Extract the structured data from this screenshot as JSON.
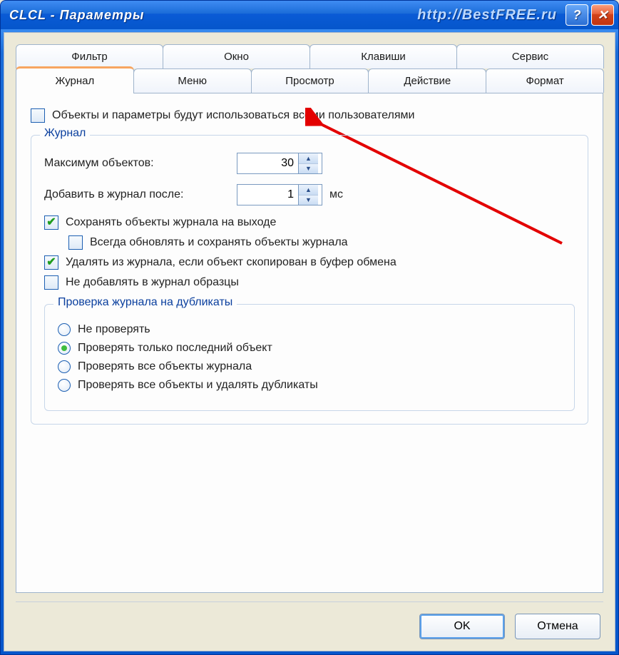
{
  "window": {
    "title": "CLCL - Параметры",
    "watermark": "http://BestFREE.ru"
  },
  "tabs": {
    "row1": [
      "Фильтр",
      "Окно",
      "Клавиши",
      "Сервис"
    ],
    "row2": [
      "Журнал",
      "Меню",
      "Просмотр",
      "Действие",
      "Формат"
    ],
    "active": "Журнал"
  },
  "shared_checkbox": {
    "label": "Объекты и параметры будут использоваться всеми пользователями",
    "checked": false
  },
  "journal_group": {
    "legend": "Журнал",
    "max_objects": {
      "label": "Максимум объектов:",
      "value": "30"
    },
    "add_after": {
      "label": "Добавить в журнал после:",
      "value": "1",
      "unit": "мс"
    },
    "save_on_exit": {
      "label": "Сохранять объекты журнала на выходе",
      "checked": true
    },
    "always_update": {
      "label": "Всегда обновлять и сохранять объекты журнала",
      "checked": false
    },
    "delete_if_copied": {
      "label": "Удалять из журнала, если объект скопирован в буфер обмена",
      "checked": true
    },
    "no_samples": {
      "label": "Не добавлять в журнал образцы",
      "checked": false
    }
  },
  "dup_group": {
    "legend": "Проверка журнала на дубликаты",
    "options": [
      "Не проверять",
      "Проверять только последний объект",
      "Проверять все объекты журнала",
      "Проверять все объекты и удалять дубликаты"
    ],
    "selected_index": 1
  },
  "buttons": {
    "ok": "OK",
    "cancel": "Отмена"
  }
}
